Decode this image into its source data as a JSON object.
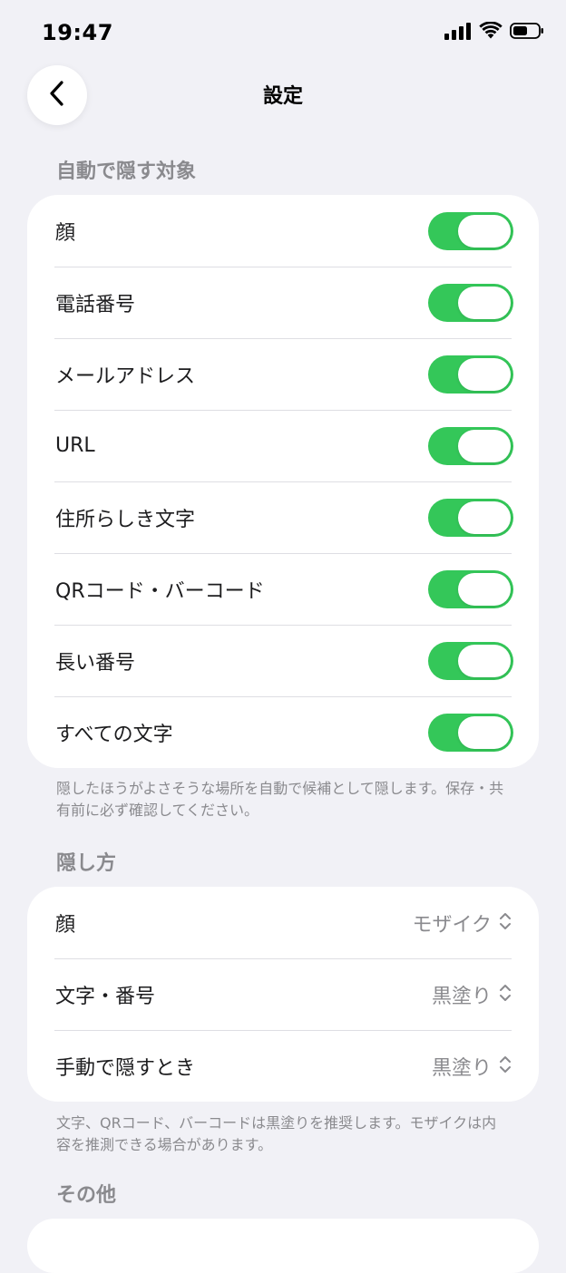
{
  "status_bar": {
    "time": "19:47",
    "icons": [
      "cellular-signal-icon",
      "wifi-icon",
      "battery-icon"
    ]
  },
  "nav": {
    "title": "設定",
    "back_icon": "chevron-left-icon"
  },
  "sections": {
    "auto_hide": {
      "header": "自動で隠す対象",
      "items": [
        {
          "label": "顔",
          "on": true
        },
        {
          "label": "電話番号",
          "on": true
        },
        {
          "label": "メールアドレス",
          "on": true
        },
        {
          "label": "URL",
          "on": true
        },
        {
          "label": "住所らしき文字",
          "on": true
        },
        {
          "label": "QRコード・バーコード",
          "on": true
        },
        {
          "label": "長い番号",
          "on": true
        },
        {
          "label": "すべての文字",
          "on": true
        }
      ],
      "footnote": "隠したほうがよさそうな場所を自動で候補として隠します。保存・共有前に必ず確認してください。"
    },
    "hide_method": {
      "header": "隠し方",
      "items": [
        {
          "label": "顔",
          "value": "モザイク"
        },
        {
          "label": "文字・番号",
          "value": "黒塗り"
        },
        {
          "label": "手動で隠すとき",
          "value": "黒塗り"
        }
      ],
      "footnote": "文字、QRコード、バーコードは黒塗りを推奨します。モザイクは内容を推測できる場合があります。"
    },
    "other": {
      "header": "その他"
    }
  },
  "colors": {
    "background": "#f1f1f6",
    "toggle_on": "#34c759",
    "secondary_text": "#8a8a8e",
    "separator": "#dedee3"
  }
}
